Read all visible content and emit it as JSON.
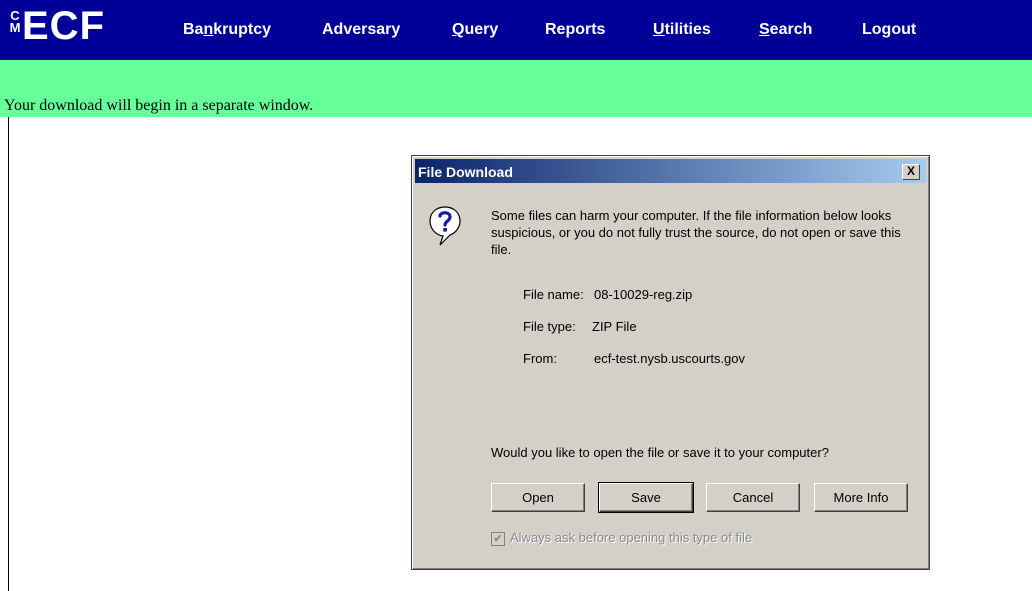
{
  "logo": {
    "cm": "CM",
    "ecf": "ECF"
  },
  "nav": [
    {
      "pre": "Ba",
      "ul": "n",
      "post": "kruptcy"
    },
    {
      "pre": "",
      "ul": "",
      "post": "Adversary"
    },
    {
      "pre": "",
      "ul": "Q",
      "post": "uery"
    },
    {
      "pre": "",
      "ul": "",
      "post": "Reports"
    },
    {
      "pre": "",
      "ul": "U",
      "post": "tilities"
    },
    {
      "pre": "",
      "ul": "S",
      "post": "earch"
    },
    {
      "pre": "",
      "ul": "",
      "post": "Logout"
    }
  ],
  "message": "Your download will begin in a separate window.",
  "dialog": {
    "title": "File Download",
    "close": "X",
    "warning": "Some files can harm your computer. If the file information below looks suspicious, or you do not fully trust the source, do not open or save this file.",
    "file_name_label": "File name:",
    "file_name": "08-10029-reg.zip",
    "file_type_label": "File type:",
    "file_type": "ZIP File",
    "from_label": "From:",
    "from": "ecf-test.nysb.uscourts.gov",
    "question": "Would you like to open the file or save it to your computer?",
    "buttons": {
      "open": "Open",
      "save": "Save",
      "cancel": "Cancel",
      "more_info": "More Info"
    },
    "checkbox_label": "Always ask before opening this type of file",
    "checkbox_checked": true
  },
  "icons": {
    "question": "question-icon",
    "close": "close-icon",
    "check": "check-icon"
  }
}
